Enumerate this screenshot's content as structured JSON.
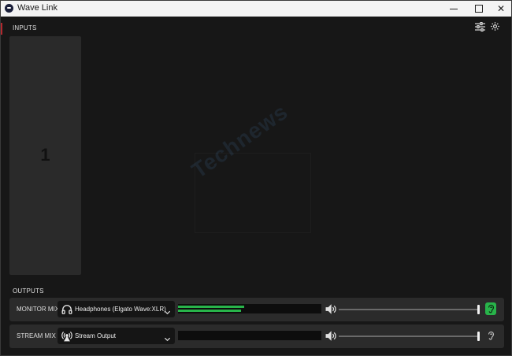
{
  "window": {
    "title": "Wave Link"
  },
  "inputs": {
    "label": "INPUTS",
    "channels": [
      {
        "number": "1"
      }
    ]
  },
  "toolbar": {
    "icons": [
      "sliders-icon",
      "gear-icon"
    ]
  },
  "watermark": {
    "text": "Technews"
  },
  "outputs": {
    "label": "OUTPUTS",
    "mixes": [
      {
        "label": "MONITOR MIX",
        "device": "Headphones (Elgato Wave:XLR)",
        "device_icon": "headphones-icon",
        "meter_levels": [
          0.46,
          0.44
        ],
        "volume": 1.0,
        "listening": true
      },
      {
        "label": "STREAM MIX",
        "device": "Stream Output",
        "device_icon": "broadcast-icon",
        "meter_levels": [
          0,
          0
        ],
        "volume": 1.0,
        "listening": false
      }
    ]
  },
  "colors": {
    "accent_green": "#28b44a",
    "accent_red": "#b4282e",
    "background": "#171717",
    "panel": "#2b2b2b"
  }
}
